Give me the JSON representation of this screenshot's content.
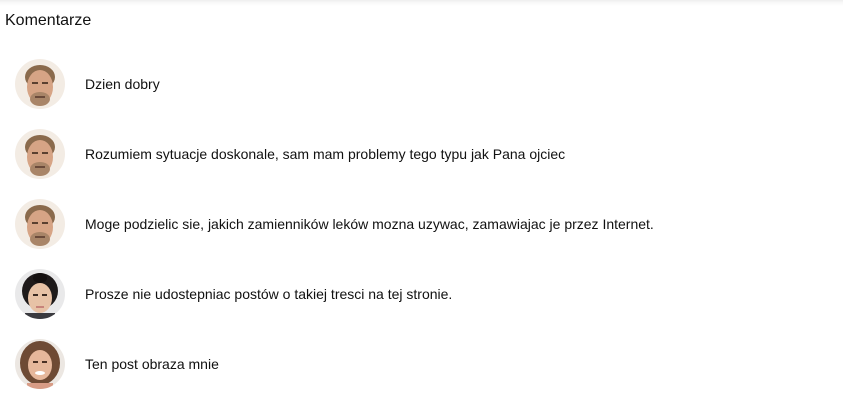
{
  "section": {
    "title": "Komentarze"
  },
  "comments": [
    {
      "avatar": "man-face-avatar",
      "text": "Dzien dobry"
    },
    {
      "avatar": "man-face-avatar",
      "text": "Rozumiem sytuacje doskonale, sam mam problemy tego typu jak Pana ojciec"
    },
    {
      "avatar": "man-face-avatar",
      "text": "Moge podzielic sie, jakich zamienników leków mozna uzywac, zamawiajac je przez Internet."
    },
    {
      "avatar": "woman-dark-hair-avatar",
      "text": "Prosze nie udostepniac postów o takiej tresci na tej stronie."
    },
    {
      "avatar": "woman-light-hair-avatar",
      "text": "Ten post obraza mnie"
    }
  ]
}
